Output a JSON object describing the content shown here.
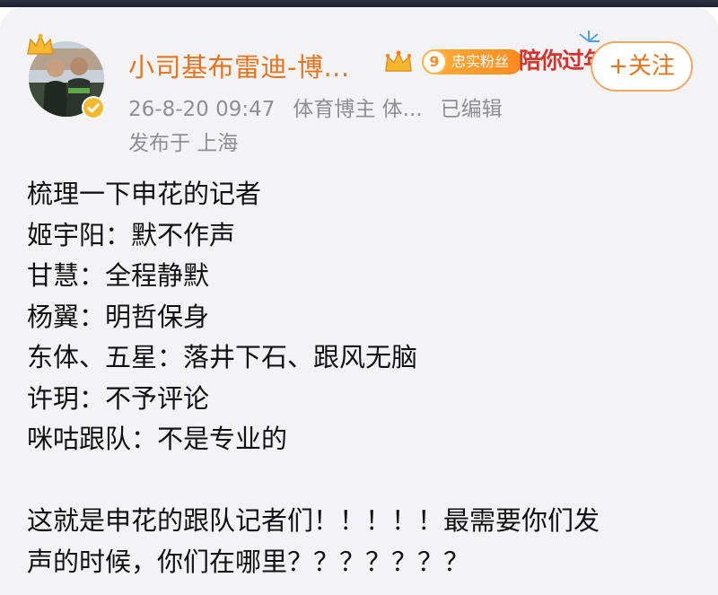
{
  "post": {
    "author": {
      "name": "小司基布雷迪-博...",
      "avatar_icon": "user-avatar",
      "crown_icon": "crown-icon",
      "verified_icon": "verified-badge-icon",
      "vip_icon": "vip-crown-icon"
    },
    "fan_badge": {
      "level": "9",
      "label": "忠实粉丝"
    },
    "festive_banner": "陪你过年",
    "follow_label": "+关注",
    "meta": {
      "time": "26-8-20 09:47",
      "category": "体育博主 体...",
      "edited": "已编辑"
    },
    "location": "发布于 上海",
    "lines": [
      "梳理一下申花的记者",
      "姬宇阳：默不作声",
      "甘慧：全程静默",
      "杨翼：明哲保身",
      "东体、五星：落井下石、跟风无脑",
      "许玥：不予评论",
      "咪咕跟队：不是专业的"
    ],
    "closing_lines": [
      "这就是申花的跟队记者们！！！！！最需要你们发",
      "声的时候，你们在哪里？？？？？？？"
    ]
  },
  "colors": {
    "accent_orange": "#e8731a",
    "meta_gray": "#8e8e93",
    "card_bg": "#f3f3f5"
  }
}
